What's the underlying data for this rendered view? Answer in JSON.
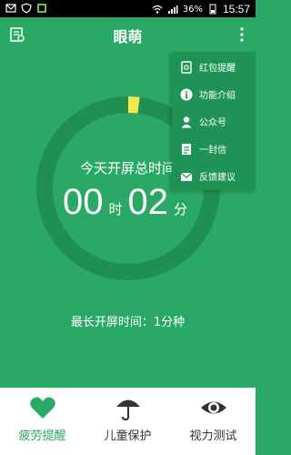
{
  "status_bar": {
    "battery_percent": "36%",
    "time": "15:57",
    "icons": [
      "mail-icon",
      "shield-icon",
      "gallery-icon",
      "wifi-icon",
      "signal-icon",
      "battery-icon"
    ]
  },
  "app_bar": {
    "title": "眼萌",
    "left_icon": "report-icon",
    "right_icon": "more-vertical-icon"
  },
  "dropdown_menu": {
    "items": [
      {
        "label": "红包提醒",
        "icon": "red-packet-icon"
      },
      {
        "label": "功能介绍",
        "icon": "info-icon"
      },
      {
        "label": "公众号",
        "icon": "person-icon"
      },
      {
        "label": "一封信",
        "icon": "document-icon"
      },
      {
        "label": "反馈建议",
        "icon": "mail-icon"
      }
    ]
  },
  "screen_time": {
    "title": "今天开屏总时间",
    "hours": "00",
    "hours_unit": "时",
    "minutes": "02",
    "minutes_unit": "分",
    "progress_fraction": 0.02,
    "max_label": "最长开屏时间：",
    "max_value": "1分种"
  },
  "bottom_nav": {
    "items": [
      {
        "label": "疲劳提醒",
        "icon": "heart-icon",
        "active": true
      },
      {
        "label": "儿童保护",
        "icon": "umbrella-icon",
        "active": false
      },
      {
        "label": "视力测试",
        "icon": "eye-icon",
        "active": false
      }
    ]
  },
  "colors": {
    "primary": "#2aa865",
    "ring_track": "#1f8f52",
    "ring_progress": "#f2e94e",
    "menu_bg": "#1f9356",
    "nav_active": "#2aa865"
  }
}
